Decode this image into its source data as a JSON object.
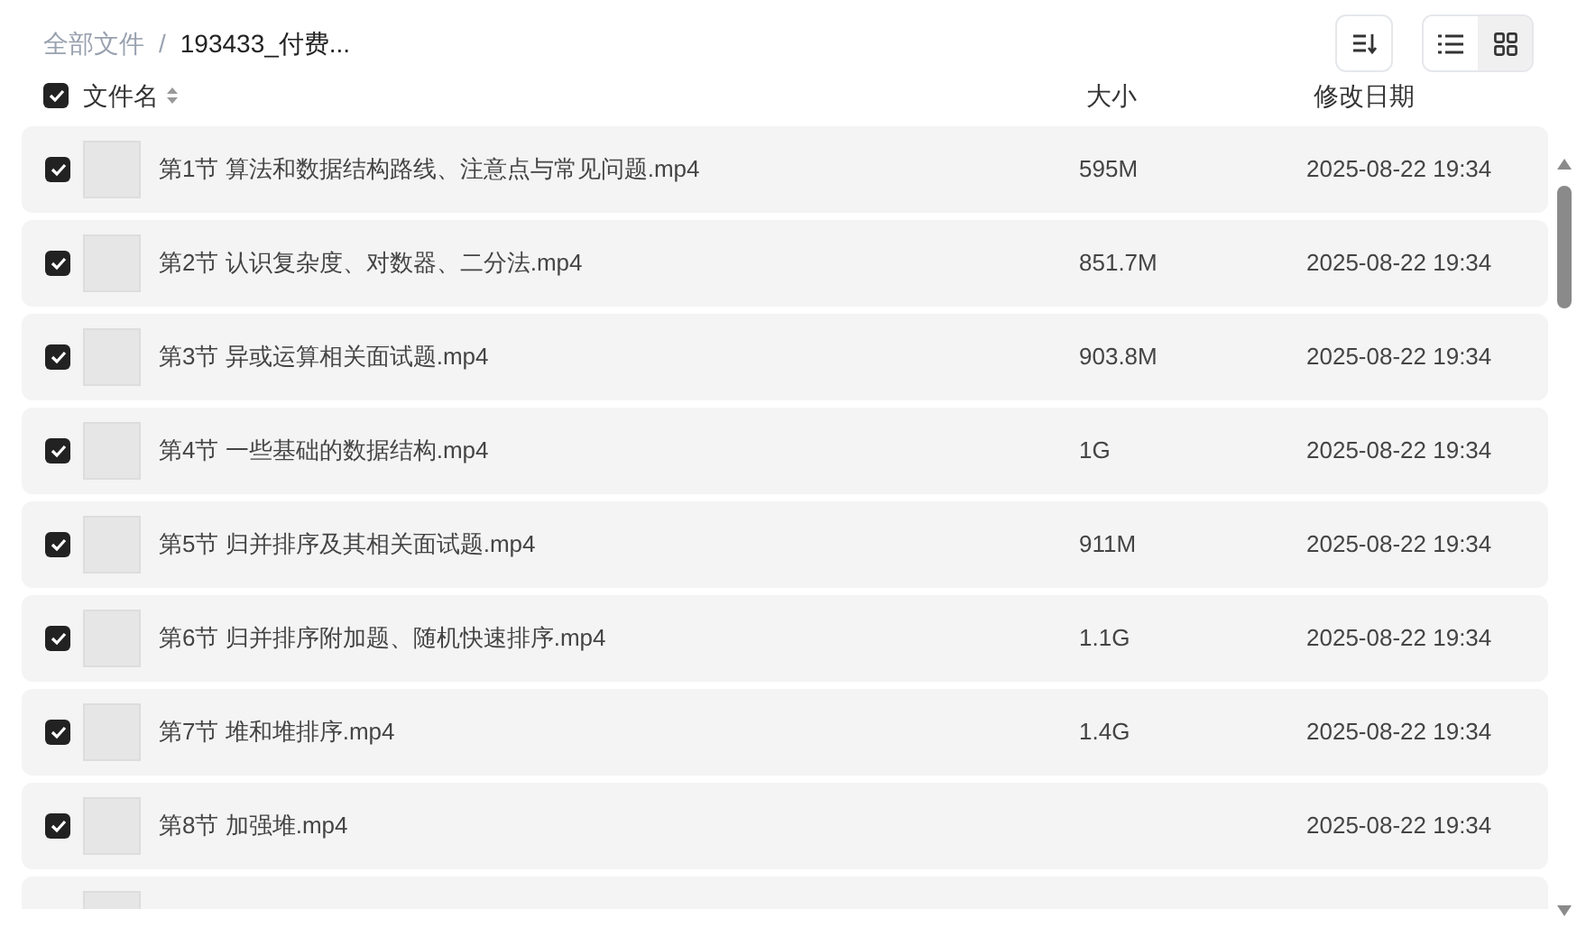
{
  "breadcrumb_separator": "/",
  "breadcrumb": [
    {
      "label": "全部文件",
      "current": false
    },
    {
      "label": "193433_付费...",
      "current": true
    }
  ],
  "toolbar": {
    "view_modes": [
      {
        "kind": "list",
        "selected": false
      },
      {
        "kind": "grid",
        "selected": true
      }
    ]
  },
  "table": {
    "select_all": {
      "checked": true
    },
    "columns": [
      "文件名",
      "大小",
      "修改日期"
    ],
    "rows": [
      {
        "checked": true,
        "name": "第1节 算法和数据结构路线、注意点与常见问题.mp4",
        "size": "595M",
        "date": "2025-08-22 19:34"
      },
      {
        "checked": true,
        "name": "第2节 认识复杂度、对数器、二分法.mp4",
        "size": "851.7M",
        "date": "2025-08-22 19:34"
      },
      {
        "checked": true,
        "name": "第3节 异或运算相关面试题.mp4",
        "size": "903.8M",
        "date": "2025-08-22 19:34"
      },
      {
        "checked": true,
        "name": "第4节 一些基础的数据结构.mp4",
        "size": "1G",
        "date": "2025-08-22 19:34"
      },
      {
        "checked": true,
        "name": "第5节 归并排序及其相关面试题.mp4",
        "size": "911M",
        "date": "2025-08-22 19:34"
      },
      {
        "checked": true,
        "name": "第6节 归并排序附加题、随机快速排序.mp4",
        "size": "1.1G",
        "date": "2025-08-22 19:34"
      },
      {
        "checked": true,
        "name": "第7节 堆和堆排序.mp4",
        "size": "1.4G",
        "date": "2025-08-22 19:34"
      },
      {
        "checked": true,
        "name": "第8节 加强堆.mp4",
        "date": "2025-08-22 19:34"
      },
      {}
    ]
  }
}
